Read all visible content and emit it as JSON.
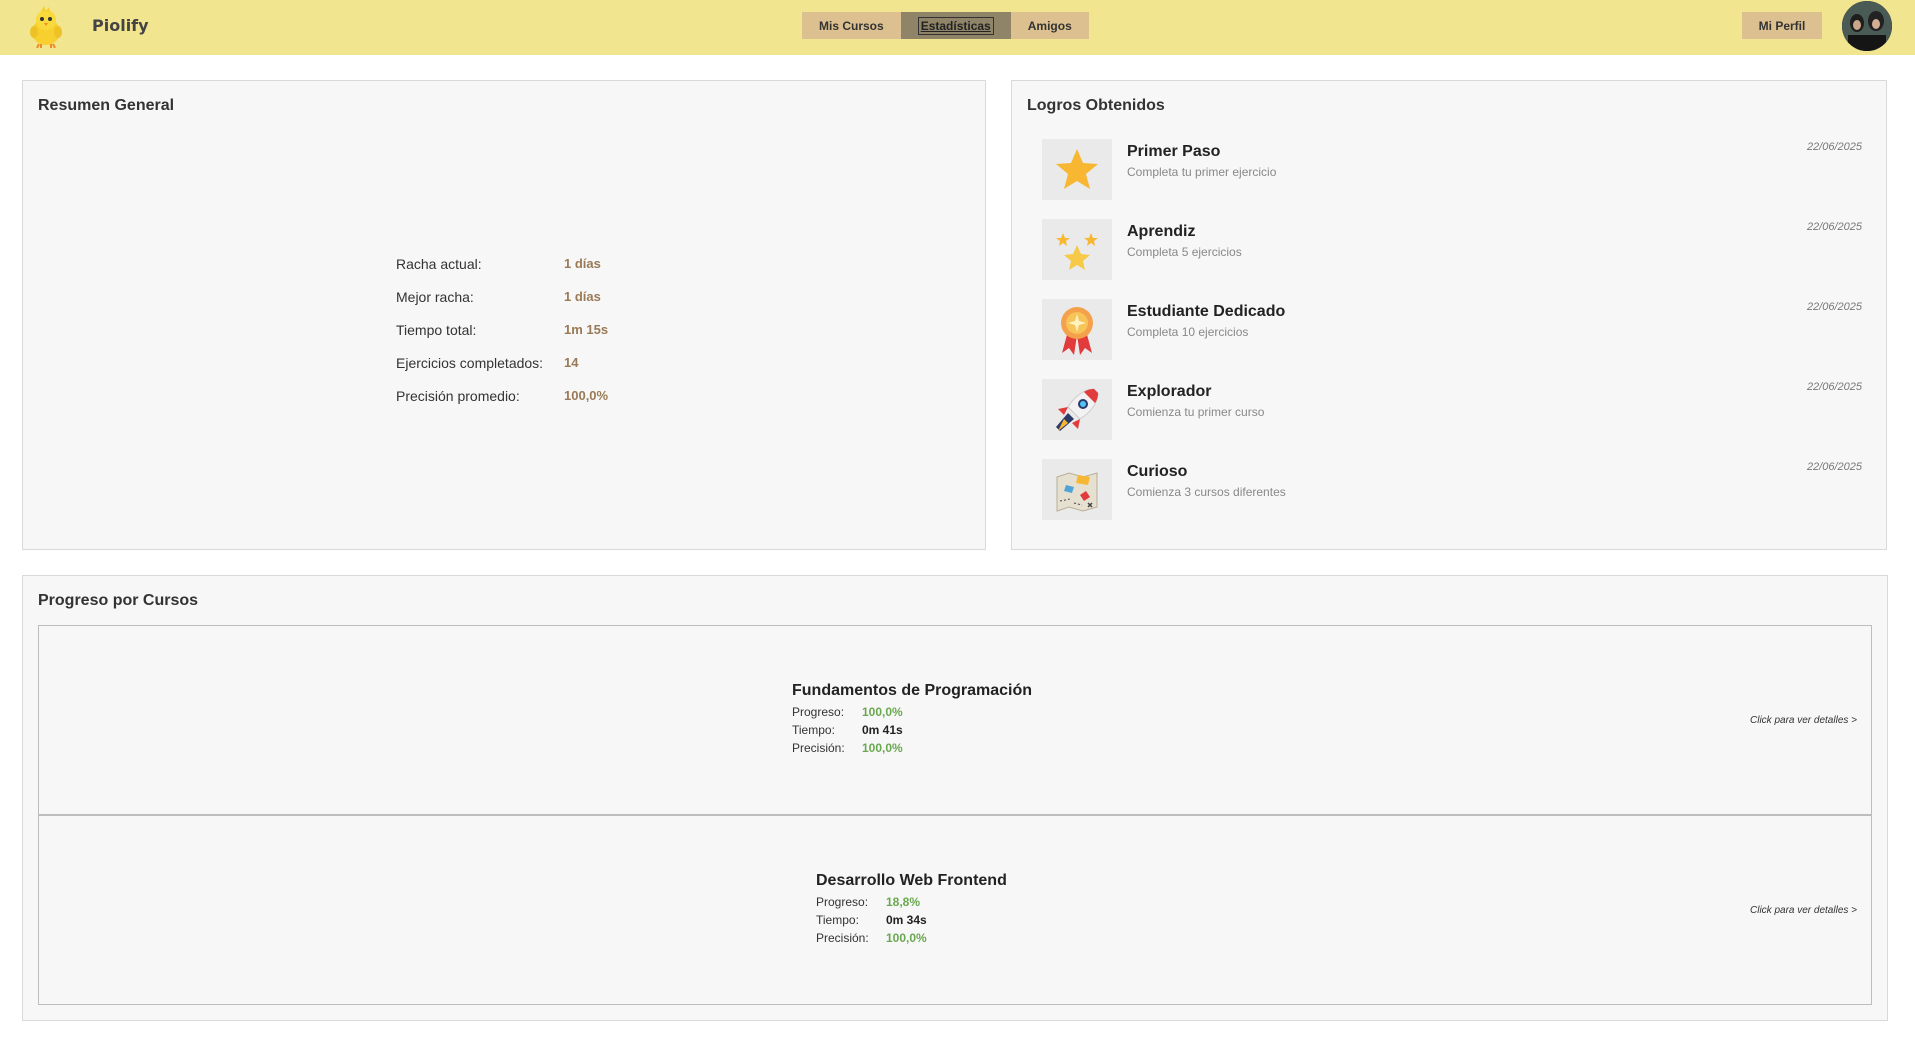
{
  "header": {
    "brand": "Piolify",
    "nav": [
      {
        "label": "Mis Cursos"
      },
      {
        "label": "Estadísticas"
      },
      {
        "label": "Amigos"
      }
    ],
    "profile_label": "Mi Perfil"
  },
  "summary": {
    "title": "Resumen General",
    "stats": [
      {
        "label": "Racha actual:",
        "value": "1 días"
      },
      {
        "label": "Mejor racha:",
        "value": "1 días"
      },
      {
        "label": "Tiempo total:",
        "value": "1m 15s"
      },
      {
        "label": "Ejercicios completados:",
        "value": "14"
      },
      {
        "label": "Precisión promedio:",
        "value": "100,0%"
      }
    ]
  },
  "achievements": {
    "title": "Logros Obtenidos",
    "items": [
      {
        "name": "Primer Paso",
        "desc": "Completa tu primer ejercicio",
        "date": "22/06/2025",
        "icon": "star-icon"
      },
      {
        "name": "Aprendiz",
        "desc": "Completa 5 ejercicios",
        "date": "22/06/2025",
        "icon": "stars-icon"
      },
      {
        "name": "Estudiante Dedicado",
        "desc": "Completa 10 ejercicios",
        "date": "22/06/2025",
        "icon": "medal-icon"
      },
      {
        "name": "Explorador",
        "desc": "Comienza tu primer curso",
        "date": "22/06/2025",
        "icon": "rocket-icon"
      },
      {
        "name": "Curioso",
        "desc": "Comienza 3 cursos diferentes",
        "date": "22/06/2025",
        "icon": "map-icon"
      }
    ]
  },
  "courses": {
    "title": "Progreso por Cursos",
    "labels": {
      "progress": "Progreso:",
      "time": "Tiempo:",
      "precision": "Precisión:"
    },
    "link_text": "Click para ver detalles >",
    "items": [
      {
        "name": "Fundamentos de Programación",
        "progress": "100,0%",
        "time": "0m 41s",
        "precision": "100,0%"
      },
      {
        "name": "Desarrollo Web Frontend",
        "progress": "18,8%",
        "time": "0m 34s",
        "precision": "100,0%"
      }
    ]
  },
  "colors": {
    "header_bg": "#f2e58f",
    "nav_bg": "#dcc08f",
    "nav_active": "#8f8468",
    "stat_value": "#9a7a56",
    "green": "#6aa84f"
  }
}
